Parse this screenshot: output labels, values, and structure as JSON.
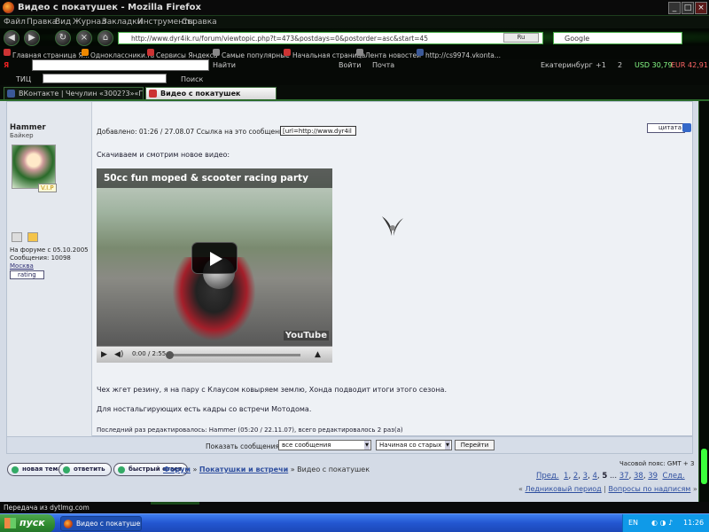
{
  "window": {
    "title": "Видео с покатушек - Mozilla Firefox"
  },
  "menu": [
    "Файл",
    "Правка",
    "Вид",
    "Журнал",
    "Закладки",
    "Инструменты",
    "Справка"
  ],
  "nav": {
    "url": "http://www.dyr4ik.ru/forum/viewtopic.php?t=473&postdays=0&postorder=asc&start=45",
    "url_badge": "Ru",
    "search": "Google"
  },
  "bookmarks": [
    "Главная страница Я...",
    "Одноклассники.ru",
    "Сервисы Яндекса",
    "Самые популярные",
    "Начальная страница",
    "Лента новостей",
    "http://cs9974.vkonta..."
  ],
  "yandex": {
    "find": "Найти",
    "enter": "Войти",
    "mail": "Почта",
    "city": "Екатеринбург",
    "weather": "+1",
    "msgs": "2",
    "usd": "USD 30,79",
    "eur": "EUR 42,91"
  },
  "toolbar2": {
    "tic": "ТИЦ",
    "search": "Поиск"
  },
  "tabs": [
    {
      "label": "ВКонтакте | Чечулин «3002?3»«Г..."
    },
    {
      "label": "Видео с покатушек"
    }
  ],
  "post": {
    "author": "Hammer",
    "rank": "Байкер",
    "vip": "V.I.P",
    "info_joined": "На форуме с 05.10.2005",
    "info_msgs": "Сообщения: 10098",
    "info_city": "Москва",
    "rating": "rating",
    "added": "Добавлено: 01:26 / 27.08.07  Ссылка на это сообщение:",
    "link_value": "[url=http://www.dyr4il",
    "quote": "цитата",
    "intro": "Скачиваем и смотрим новое видео:",
    "video_title": "50cc fun moped & scooter racing party",
    "video_time": "0:00 / 2:55",
    "youtube": "YouTube",
    "text1": "Чех жгет резину, я на пару с Клаусом ковыряем землю, Хонда подводит итоги этого сезона.",
    "text2": "Для ностальгирующих есть кадры со встречи Мотодома.",
    "edited": "Последний раз редактировалось: Hammer (05:20 / 22.11.07), всего редактировалось 2 раз(а)"
  },
  "form": {
    "label": "Показать сообщения:",
    "filter": "все сообщения",
    "order": "Начиная со старых",
    "go": "Перейти"
  },
  "actions": {
    "new": "новая тема",
    "reply": "ответить",
    "quick": "быстрый ответ"
  },
  "breadcrumb": {
    "forum": "Форум",
    "sep1": " » ",
    "section": "Покатушки и встречи",
    "sep2": " » ",
    "topic": "Видео с покатушек"
  },
  "timezone": "Часовой пояс: GMT + 3",
  "pages": {
    "prev": "Пред.",
    "p1": "1",
    "p2": "2",
    "p3": "3",
    "p4": "4",
    "p5": "5",
    "dots": "...",
    "p37": "37",
    "p38": "38",
    "p39": "39",
    "next": "След."
  },
  "navlinks": {
    "prev": "Ледниковый период",
    "sep": " | ",
    "next": "Вопросы по надписям"
  },
  "status": "Передача из dytlmg.com",
  "taskbar": {
    "start": "пуск",
    "task": "Видео с покатушек ...",
    "lang": "EN",
    "time": "11:26"
  }
}
